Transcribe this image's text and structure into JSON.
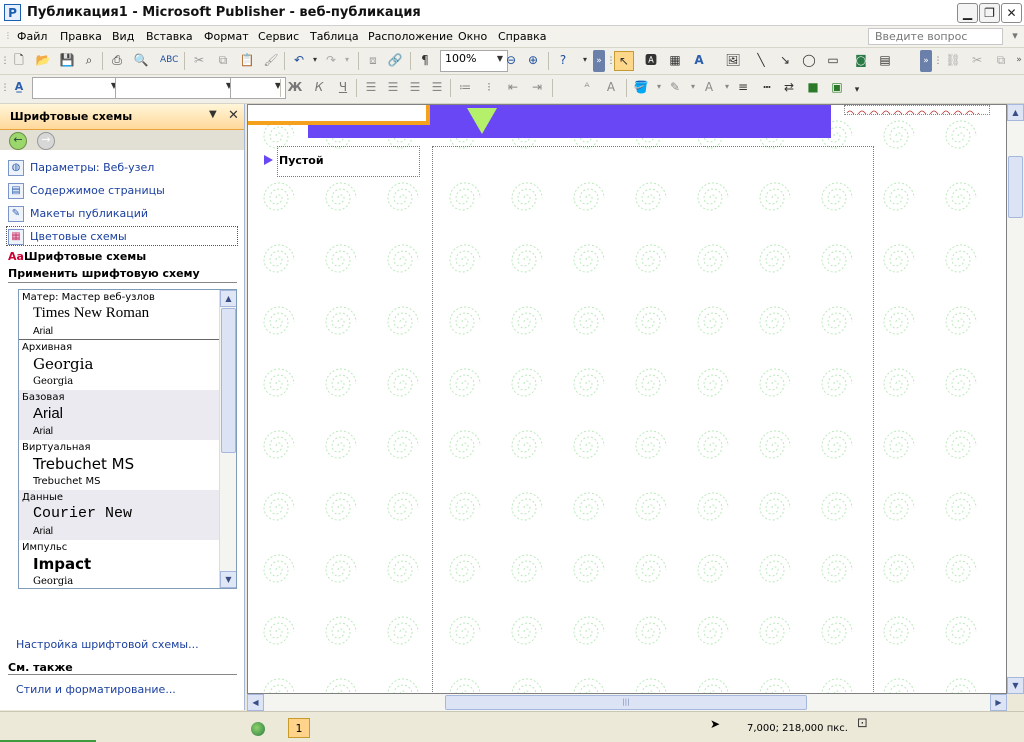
{
  "window": {
    "title": "Публикация1 - Microsoft Publisher - веб-публикация",
    "app_icon": "P",
    "minimize_icon": "minimize-icon",
    "maximize_icon": "restore-icon",
    "close_icon": "close-icon"
  },
  "menubar": {
    "items": [
      "Файл",
      "Правка",
      "Вид",
      "Вставка",
      "Формат",
      "Сервис",
      "Таблица",
      "Расположение",
      "Окно",
      "Справка"
    ],
    "help_placeholder": "Введите вопрос"
  },
  "toolbar_standard": {
    "zoom_value": "100%"
  },
  "toolbar_format": {
    "style_value": "",
    "font_value": "",
    "size_value": "",
    "bold": "Ж",
    "italic": "К",
    "underline": "Ч"
  },
  "taskpane": {
    "title": "Шрифтовые схемы",
    "links": [
      {
        "label": "Параметры: Веб-узел",
        "icon": "globe-icon"
      },
      {
        "label": "Содержимое страницы",
        "icon": "page-icon"
      },
      {
        "label": "Макеты публикаций",
        "icon": "layout-icon"
      },
      {
        "label": "Цветовые схемы",
        "icon": "palette-icon"
      }
    ],
    "current": "Шрифтовые схемы",
    "current_icon_text": "Aa",
    "section_heading": "Применить шрифтовую схему",
    "schemes": [
      {
        "name": "Матер: Мастер веб-узлов",
        "major": "Times New Roman",
        "minor": "Arial"
      },
      {
        "name": "Архивная",
        "major": "Georgia",
        "minor": "Georgia"
      },
      {
        "name": "Базовая",
        "major": "Arial",
        "minor": "Arial"
      },
      {
        "name": "Виртуальная",
        "major": "Trebuchet MS",
        "minor": "Trebuchet MS"
      },
      {
        "name": "Данные",
        "major": "Courier New",
        "minor": "Arial"
      },
      {
        "name": "Импульс",
        "major": "Impact",
        "minor": "Georgia"
      }
    ],
    "customize_link": "Настройка шрифтовой схемы...",
    "see_also_heading": "См. также",
    "styles_link": "Стили и форматирование..."
  },
  "document": {
    "nav_label": "Пустой",
    "banner_color": "#6a47f5",
    "accent_color": "#f5a11c"
  },
  "statusbar": {
    "page_number": "1",
    "coordinates": "7,000; 218,000 пкс."
  }
}
